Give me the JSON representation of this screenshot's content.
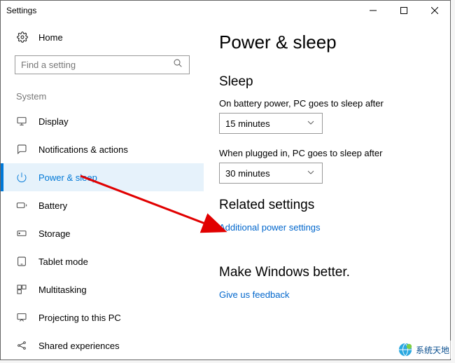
{
  "window": {
    "title": "Settings"
  },
  "sidebar": {
    "home_label": "Home",
    "search_placeholder": "Find a setting",
    "group_header": "System",
    "items": [
      {
        "label": "Display"
      },
      {
        "label": "Notifications & actions"
      },
      {
        "label": "Power & sleep"
      },
      {
        "label": "Battery"
      },
      {
        "label": "Storage"
      },
      {
        "label": "Tablet mode"
      },
      {
        "label": "Multitasking"
      },
      {
        "label": "Projecting to this PC"
      },
      {
        "label": "Shared experiences"
      }
    ]
  },
  "main": {
    "title": "Power & sleep",
    "sleep": {
      "heading": "Sleep",
      "battery_label": "On battery power, PC goes to sleep after",
      "battery_value": "15 minutes",
      "plugged_label": "When plugged in, PC goes to sleep after",
      "plugged_value": "30 minutes"
    },
    "related": {
      "heading": "Related settings",
      "link": "Additional power settings"
    },
    "feedback": {
      "heading": "Make Windows better.",
      "link": "Give us feedback"
    }
  },
  "watermark": "系统天地"
}
